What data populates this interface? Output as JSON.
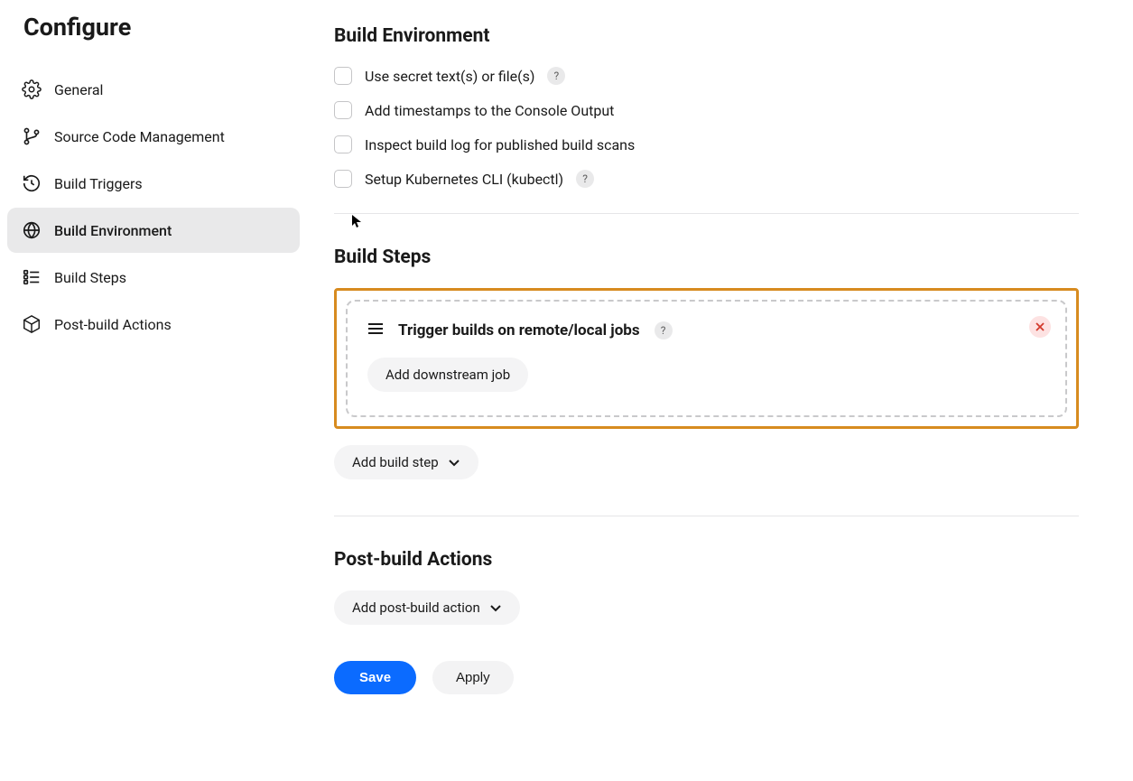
{
  "page_title": "Configure",
  "sidebar": {
    "items": [
      {
        "label": "General"
      },
      {
        "label": "Source Code Management"
      },
      {
        "label": "Build Triggers"
      },
      {
        "label": "Build Environment"
      },
      {
        "label": "Build Steps"
      },
      {
        "label": "Post-build Actions"
      }
    ]
  },
  "build_environment": {
    "title": "Build Environment",
    "options": [
      {
        "label": "Use secret text(s) or file(s)",
        "help": true
      },
      {
        "label": "Add timestamps to the Console Output",
        "help": false
      },
      {
        "label": "Inspect build log for published build scans",
        "help": false
      },
      {
        "label": "Setup Kubernetes CLI (kubectl)",
        "help": true
      }
    ]
  },
  "build_steps": {
    "title": "Build Steps",
    "step": {
      "title": "Trigger builds on remote/local jobs",
      "add_downstream_label": "Add downstream job"
    },
    "add_step_label": "Add build step"
  },
  "post_build": {
    "title": "Post-build Actions",
    "add_action_label": "Add post-build action"
  },
  "buttons": {
    "save": "Save",
    "apply": "Apply"
  },
  "help_char": "?"
}
